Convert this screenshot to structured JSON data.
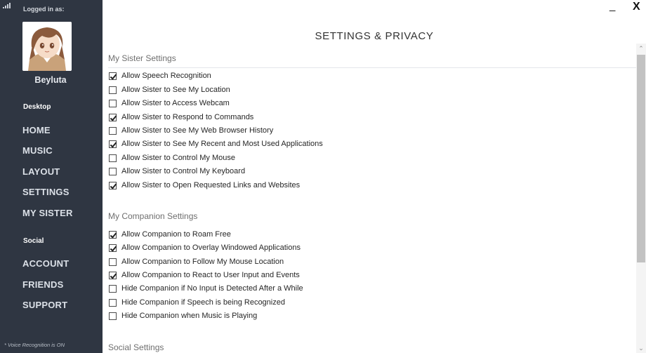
{
  "window": {
    "minimize_label": "_",
    "close_label": "X"
  },
  "sidebar": {
    "logged_in_label": "Logged in as:",
    "username": "Beyluta",
    "desktop_section": "Desktop",
    "desktop_items": [
      "HOME",
      "MUSIC",
      "LAYOUT",
      "SETTINGS",
      "MY SISTER"
    ],
    "social_section": "Social",
    "social_items": [
      "ACCOUNT",
      "FRIENDS",
      "SUPPORT"
    ],
    "voice_status": "* Voice Recognition is ON"
  },
  "page_title": "SETTINGS & PRIVACY",
  "groups": [
    {
      "title": "My Sister Settings",
      "options": [
        {
          "label": "Allow Speech Recognition",
          "checked": true
        },
        {
          "label": "Allow Sister to See My Location",
          "checked": false
        },
        {
          "label": "Allow Sister to Access Webcam",
          "checked": false
        },
        {
          "label": "Allow Sister to Respond to Commands",
          "checked": true
        },
        {
          "label": "Allow Sister to See My Web Browser History",
          "checked": false
        },
        {
          "label": "Allow Sister to See My Recent and Most Used Applications",
          "checked": true
        },
        {
          "label": "Allow Sister to Control My Mouse",
          "checked": false
        },
        {
          "label": "Allow Sister to Control My Keyboard",
          "checked": false
        },
        {
          "label": "Allow Sister to Open Requested Links and Websites",
          "checked": true
        }
      ]
    },
    {
      "title": "My Companion Settings",
      "options": [
        {
          "label": "Allow Companion to Roam Free",
          "checked": true
        },
        {
          "label": "Allow Companion to Overlay Windowed Applications",
          "checked": true
        },
        {
          "label": "Allow Companion to Follow My Mouse Location",
          "checked": false
        },
        {
          "label": "Allow Companion to React to User Input and Events",
          "checked": true
        },
        {
          "label": "Hide Companion if No Input is Detected After a While",
          "checked": false
        },
        {
          "label": "Hide Companion if Speech is being Recognized",
          "checked": false
        },
        {
          "label": "Hide Companion when Music is Playing",
          "checked": false
        }
      ]
    },
    {
      "title": "Social Settings",
      "options": []
    }
  ],
  "icons": {
    "scroll_up": "chevron-up-icon",
    "scroll_down": "chevron-down-icon",
    "signal": "signal-bars-icon",
    "avatar": "user-avatar-icon"
  }
}
